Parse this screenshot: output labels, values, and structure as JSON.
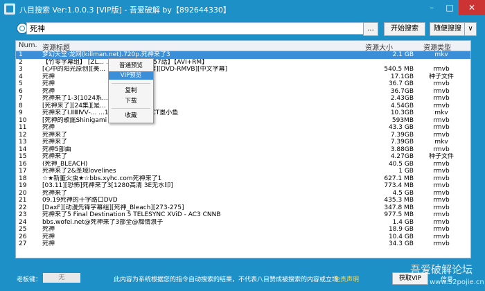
{
  "window": {
    "title": "八目搜索 Ver:1.0.0.3 [VIP版]  - 吾爱破解 by【892644330】",
    "minimize": "–",
    "maximize": "□",
    "close": "✕"
  },
  "search": {
    "query": "死神",
    "more_label": "...",
    "start_label": "开始搜索",
    "random_label": "随便搜搜",
    "dropdown_label": "∨"
  },
  "columns": {
    "num": "Num.",
    "title": "资源标题",
    "size": "资源大小",
    "type": "资源类型"
  },
  "rows": [
    {
      "num": "1",
      "title": "梦幻天堂·龙网(killman.net).720p.死神来了3",
      "size": "2.1 GB",
      "type": "mkv"
    },
    {
      "num": "2",
      "title": "【竹零字幕组】 [ZL... ...each 第153-157話】【AVI+RM】",
      "size": "",
      "type": ""
    },
    {
      "num": "3",
      "title": "[心中的阳光原创][美... ...中的死神+花絮][DVD-RMVB][中文字幕]",
      "size": "540.5 MB",
      "type": "rmvb"
    },
    {
      "num": "4",
      "title": "死神",
      "size": "17.1GB",
      "type": "种子文件"
    },
    {
      "num": "5",
      "title": "死神",
      "size": "36.7 GB",
      "type": "rmvb"
    },
    {
      "num": "6",
      "title": "死神",
      "size": "36.7GB",
      "type": "rmvb"
    },
    {
      "num": "7",
      "title": "死神来了1-3(1024系... ...ss",
      "size": "2.43GB",
      "type": "rmvb"
    },
    {
      "num": "8",
      "title": "[死神来了][24集][是... ...DVD-RMVB]",
      "size": "4.54GB",
      "type": "rmvb"
    },
    {
      "num": "9",
      "title": "死神来了Ⅰ.ⅡⅢⅣⅤ-... ...1.中英字幕￡CMCT墨小鱼",
      "size": "10.3GB",
      "type": "mkv"
    },
    {
      "num": "10",
      "title": "[死神的歌謠Shinigami no ballad]",
      "size": "593MB",
      "type": "rmvb"
    },
    {
      "num": "11",
      "title": "死神",
      "size": "43.3 GB",
      "type": "rmvb"
    },
    {
      "num": "12",
      "title": "死神来了",
      "size": "7.39GB",
      "type": "rmvb"
    },
    {
      "num": "13",
      "title": "死神来了",
      "size": "7.39GB",
      "type": "mkv"
    },
    {
      "num": "14",
      "title": "死神5部曲",
      "size": "3.88GB",
      "type": "rmvb"
    },
    {
      "num": "15",
      "title": "死神来了",
      "size": "4.27GB",
      "type": "种子文件"
    },
    {
      "num": "16",
      "title": "(死神_BLEACH)",
      "size": "40.5 GB",
      "type": "rmvb"
    },
    {
      "num": "17",
      "title": "死神来了2&圣域lovelines",
      "size": "1 GB",
      "type": "rmvb"
    },
    {
      "num": "18",
      "title": "☆★新董火虫★☆bbs.xyhc.com死神来了1",
      "size": "627.1 MB",
      "type": "rmvb"
    },
    {
      "num": "19",
      "title": "[03.11][恐怖]死神来了3[1280高清 3E无水印]",
      "size": "773.4 MB",
      "type": "rmvb"
    },
    {
      "num": "20",
      "title": "死神来了",
      "size": "4.5 GB",
      "type": "rmvb"
    },
    {
      "num": "21",
      "title": "09.19死神的十字路口DVD",
      "size": "435.3 MB",
      "type": "rmvb"
    },
    {
      "num": "22",
      "title": "[DaxF][动漫先锋字幕组][死神_Bleach][273-275]",
      "size": "347.8 MB",
      "type": "rmvb"
    },
    {
      "num": "23",
      "title": "死神来了5 Final Destination 5 TELESYNC  XViD - AC3 CNNB",
      "size": "977.5 MB",
      "type": "rmvb"
    },
    {
      "num": "24",
      "title": "bbs.wofei.net@死神来了3部全@痴情浪子",
      "size": "1.4 GB",
      "type": "rmvb"
    },
    {
      "num": "25",
      "title": "死神",
      "size": "18.9 GB",
      "type": "rmvb"
    },
    {
      "num": "26",
      "title": "死神",
      "size": "10.4 GB",
      "type": "rmvb"
    },
    {
      "num": "27",
      "title": "死神",
      "size": "34.3 GB",
      "type": "rmvb"
    }
  ],
  "context_menu": {
    "normal_preview": "普通预览",
    "vip_preview": "VIP预览",
    "copy": "复制",
    "download": "下载",
    "favorite": "收藏"
  },
  "footer": {
    "board_label": "老板键：",
    "board_value": "无",
    "notice": "此内容为系统根据您的指令自动搜索的结果，不代表八目赞成被搜索的内容或立场",
    "disclaimer": "免责声明",
    "get_vip": "获取VIP",
    "info": "信息"
  },
  "watermark": {
    "line1": "吾爱破解论坛",
    "line2": "www.52pojie.cn"
  }
}
